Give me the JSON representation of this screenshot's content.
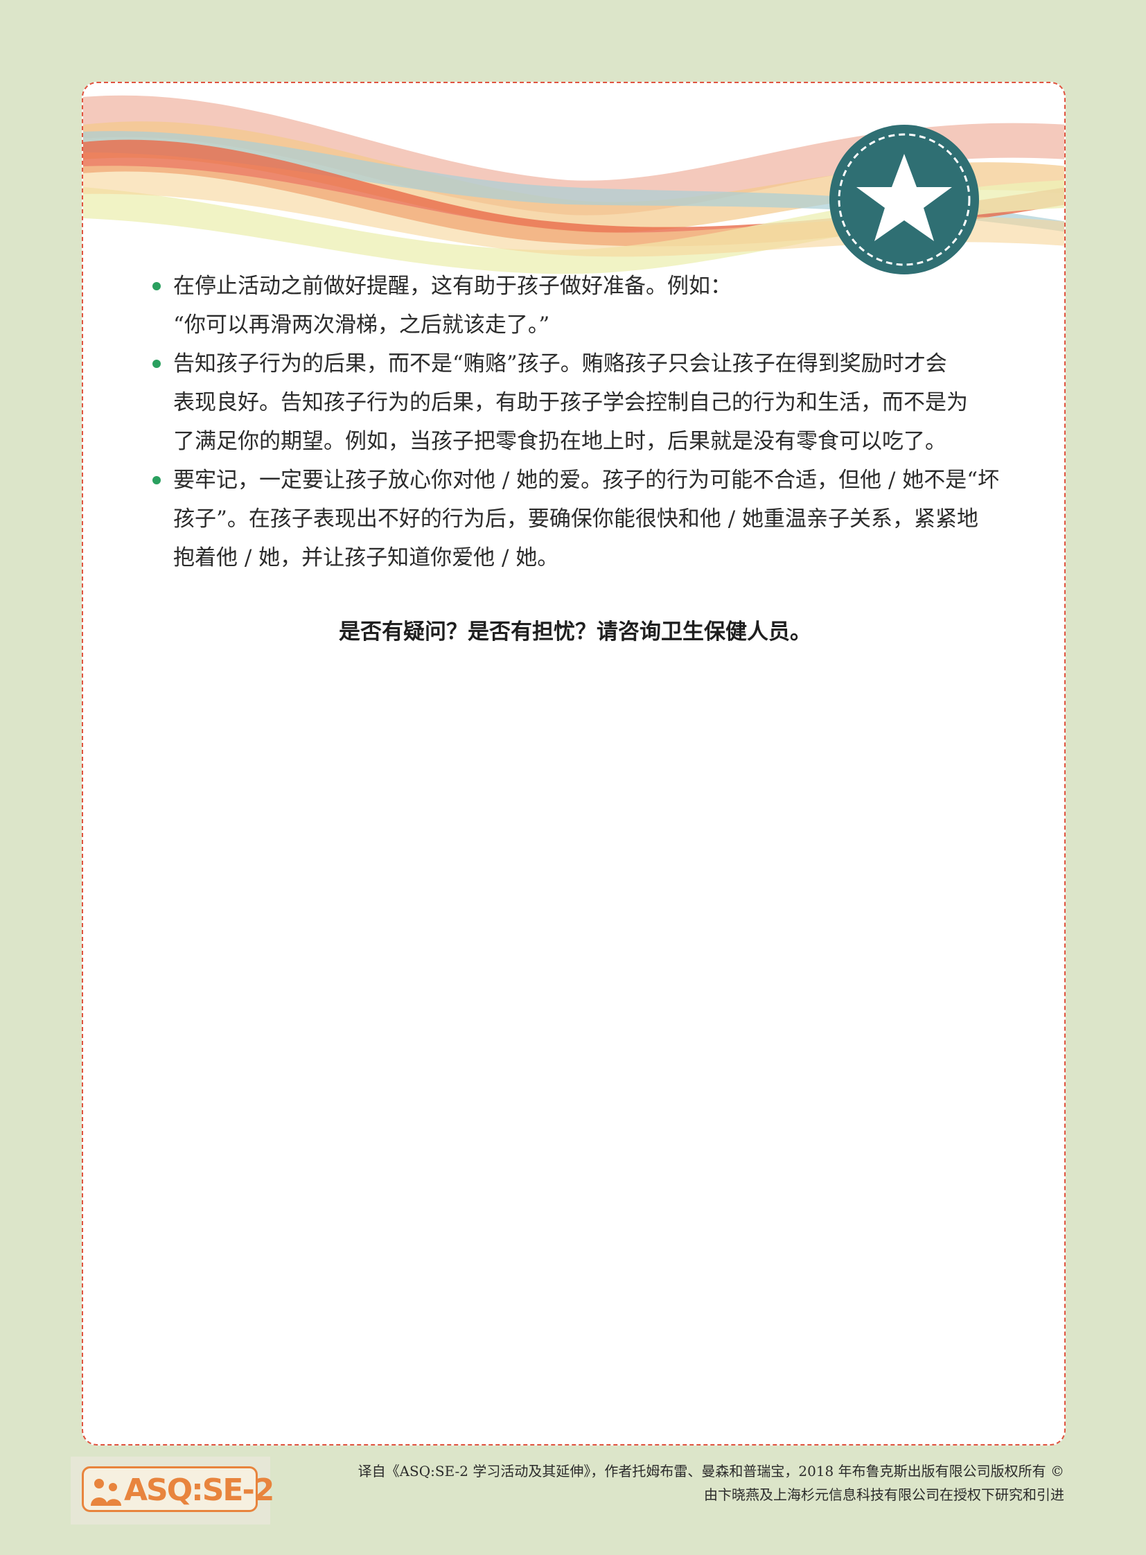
{
  "bullets": [
    {
      "lines": [
        "在停止活动之前做好提醒，这有助于孩子做好准备。例如：",
        "“你可以再滑两次滑梯，之后就该走了。”"
      ]
    },
    {
      "lines": [
        "告知孩子行为的后果，而不是“贿赂”孩子。贿赂孩子只会让孩子在得到奖励时才会",
        "表现良好。告知孩子行为的后果，有助于孩子学会控制自己的行为和生活，而不是为",
        "了满足你的期望。例如，当孩子把零食扔在地上时，后果就是没有零食可以吃了。"
      ]
    },
    {
      "lines": [
        "要牢记，一定要让孩子放心你对他 / 她的爱。孩子的行为可能不合适，但他 / 她不是“坏",
        "孩子”。在孩子表现出不好的行为后，要确保你能很快和他 / 她重温亲子关系，紧紧地",
        "抱着他 / 她，并让孩子知道你爱他 / 她。"
      ]
    }
  ],
  "question_line": "是否有疑问？是否有担忧？请咨询卫生保健人员。",
  "logo": {
    "text": "ASQ:SE-2",
    "color": "#e8843d"
  },
  "footer": {
    "line1": "译自《ASQ:SE-2 学习活动及其延伸》，作者托姆布雷、曼森和普瑞宝，2018 年布鲁克斯出版有限公司版权所有 ©",
    "line2": "由卞晓燕及上海杉元信息科技有限公司在授权下研究和引进"
  },
  "colors": {
    "page_background": "#dce5c9",
    "card_border": "#e0533f",
    "bullet": "#2aa05f",
    "badge": "#2f6f73"
  },
  "icons": {
    "badge": "star-icon",
    "logo": "people-icon"
  }
}
